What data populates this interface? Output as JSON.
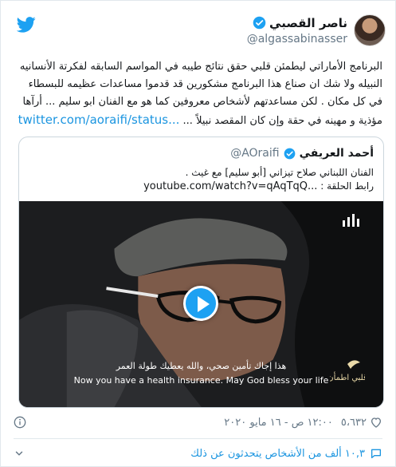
{
  "author": {
    "name": "ناصر القصبي",
    "handle": "@algassabinasser"
  },
  "tweet": {
    "text": "البرنامج الأماراتي ليطمئن قلبي حقق نتائج طيبه في المواسم السابقه لفكرتة الأنسانيه النبيله ولا شك ان صناع هذا البرنامج مشكورين قد قدموا مساعدات عظيمه للبسطاء في كل مكان . لكن مساعدتهم لأشخاص معروفين كما هو مع الفنان ابو سليم ... أرآها مؤذية و مهينه في حقة وإن كان المقصد نبيلاً ...",
    "link": "twitter.com/aoraifi/status..."
  },
  "quote": {
    "name": "أحمد العريفي",
    "handle": "@AOraifi",
    "line1": "الفنان اللبناني صلاح تيزاني [أبو سليم] مع غيث .",
    "line2": "رابط الحلقة :",
    "link": "youtube.com/watch?v=qAqTqQ...",
    "video": {
      "subtitle_ar": "هذا إجاك تأمين صحي، والله يعطيك طولة العمر",
      "subtitle_en": "Now you have a health insurance. May God bless your life",
      "logo_text": "قلبي اطمأن"
    }
  },
  "meta": {
    "likes": "٥،٦٣٢",
    "timestamp": "١٢:٠٠ ص - ١٦ مايو ٢٠٢٠"
  },
  "footer": {
    "talk_text": "١٠,٣ ألف من الأشخاص يتحدثون عن ذلك"
  },
  "colors": {
    "twitter_blue": "#1da1f2",
    "link_blue": "#1b95e0",
    "muted_gray": "#657786",
    "heart_gray": "#657786"
  },
  "icons": {
    "twitter": "twitter-bird-icon",
    "verified": "verified-badge-icon",
    "play": "play-icon",
    "heart": "heart-icon",
    "info": "info-icon",
    "chevron": "chevron-down-icon",
    "bubble": "speech-bubble-icon"
  }
}
